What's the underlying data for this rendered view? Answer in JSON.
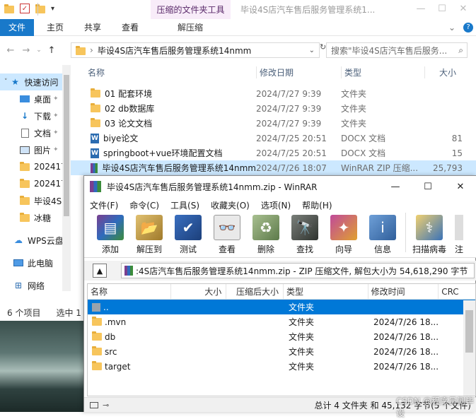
{
  "explorer": {
    "title": "毕设4S店汽车售后服务管理系统1...",
    "context_tab": "压缩的文件夹工具",
    "context_tab_sub": "解压缩",
    "ribbon_tabs": [
      "文件",
      "主页",
      "共享",
      "查看"
    ],
    "address": "毕设4S店汽车售后服务管理系统14nmm",
    "search_placeholder": "搜索\"毕设4S店汽车售后服务...",
    "columns": {
      "name": "名称",
      "date": "修改日期",
      "type": "类型",
      "size": "大小"
    },
    "files": [
      {
        "name": "01 配套环境",
        "date": "2024/7/27 9:39",
        "type": "文件夹",
        "size": "",
        "icon": "folder"
      },
      {
        "name": "02 db数据库",
        "date": "2024/7/27 9:39",
        "type": "文件夹",
        "size": "",
        "icon": "folder"
      },
      {
        "name": "03 论文文档",
        "date": "2024/7/27 9:39",
        "type": "文件夹",
        "size": "",
        "icon": "folder"
      },
      {
        "name": "biye论文",
        "date": "2024/7/25 20:51",
        "type": "DOCX 文档",
        "size": "81",
        "icon": "docx"
      },
      {
        "name": "springboot+vue环境配置文档",
        "date": "2024/7/25 20:51",
        "type": "DOCX 文档",
        "size": "15",
        "icon": "docx"
      },
      {
        "name": "毕设4S店汽车售后服务管理系统14nmm",
        "date": "2024/7/26 18:07",
        "type": "WinRAR ZIP 压缩...",
        "size": "25,793",
        "icon": "rar"
      }
    ],
    "nav": [
      {
        "label": "快速访问",
        "icon": "star-icon"
      },
      {
        "label": "桌面",
        "icon": "desktop-icon"
      },
      {
        "label": "下载",
        "icon": "download-icon"
      },
      {
        "label": "文档",
        "icon": "document-icon"
      },
      {
        "label": "图片",
        "icon": "picture-icon"
      },
      {
        "label": "202417",
        "icon": "folder-icon"
      },
      {
        "label": "202417",
        "icon": "folder-icon"
      },
      {
        "label": "毕设4S",
        "icon": "folder-icon"
      },
      {
        "label": "冰糖",
        "icon": "folder-icon"
      },
      {
        "label": "WPS云盘",
        "icon": "cloud-icon"
      },
      {
        "label": "此电脑",
        "icon": "pc-icon"
      },
      {
        "label": "网络",
        "icon": "network-icon"
      }
    ],
    "status_items": "6 个项目",
    "status_selected": "选中 1"
  },
  "winrar": {
    "title": "毕设4S店汽车售后服务管理系统14nmm.zip - WinRAR",
    "menu": [
      "文件(F)",
      "命令(C)",
      "工具(S)",
      "收藏夹(O)",
      "选项(N)",
      "帮助(H)"
    ],
    "toolbar": [
      {
        "label": "添加",
        "icon": "add-icon",
        "color": "#7a3f8f"
      },
      {
        "label": "解压到",
        "icon": "extract-icon",
        "color": "#c9a24a"
      },
      {
        "label": "测试",
        "icon": "test-icon",
        "color": "#2f5fa8"
      },
      {
        "label": "查看",
        "icon": "view-icon",
        "color": "#a7a7a7"
      },
      {
        "label": "删除",
        "icon": "delete-icon",
        "color": "#7d9a6a"
      },
      {
        "label": "查找",
        "icon": "find-icon",
        "color": "#555a55"
      },
      {
        "label": "向导",
        "icon": "wizard-icon",
        "color": "#8c3e86"
      },
      {
        "label": "信息",
        "icon": "info-icon",
        "color": "#3f6ea8"
      },
      {
        "label": "扫描病毒",
        "icon": "scan-virus-icon",
        "color": "#d1b04a"
      },
      {
        "label": "注",
        "icon": "comment-icon",
        "color": "#cfcfcf"
      }
    ],
    "path": ":4S店汽车售后服务管理系统14nmm.zip - ZIP 压缩文件, 解包大小为 54,618,290 字节",
    "columns": {
      "name": "名称",
      "size": "大小",
      "packed": "压缩后大小",
      "type": "类型",
      "mtime": "修改时间",
      "crc": "CRC"
    },
    "rows": [
      {
        "name": "..",
        "size": "",
        "packed": "",
        "type": "文件夹",
        "mtime": "",
        "crc": "",
        "icon": "up-folder"
      },
      {
        "name": ".mvn",
        "size": "",
        "packed": "",
        "type": "文件夹",
        "mtime": "2024/7/26 18...",
        "crc": "",
        "icon": "folder"
      },
      {
        "name": "db",
        "size": "",
        "packed": "",
        "type": "文件夹",
        "mtime": "2024/7/26 18...",
        "crc": "",
        "icon": "folder"
      },
      {
        "name": "src",
        "size": "",
        "packed": "",
        "type": "文件夹",
        "mtime": "2024/7/26 18...",
        "crc": "",
        "icon": "folder"
      },
      {
        "name": "target",
        "size": "",
        "packed": "",
        "type": "文件夹",
        "mtime": "2024/7/26 18...",
        "crc": "",
        "icon": "folder"
      }
    ],
    "status": "总计 4 文件夹 和 45,132 字节(5 个文件)"
  },
  "watermark": "CSDN @程序员侧毕设"
}
